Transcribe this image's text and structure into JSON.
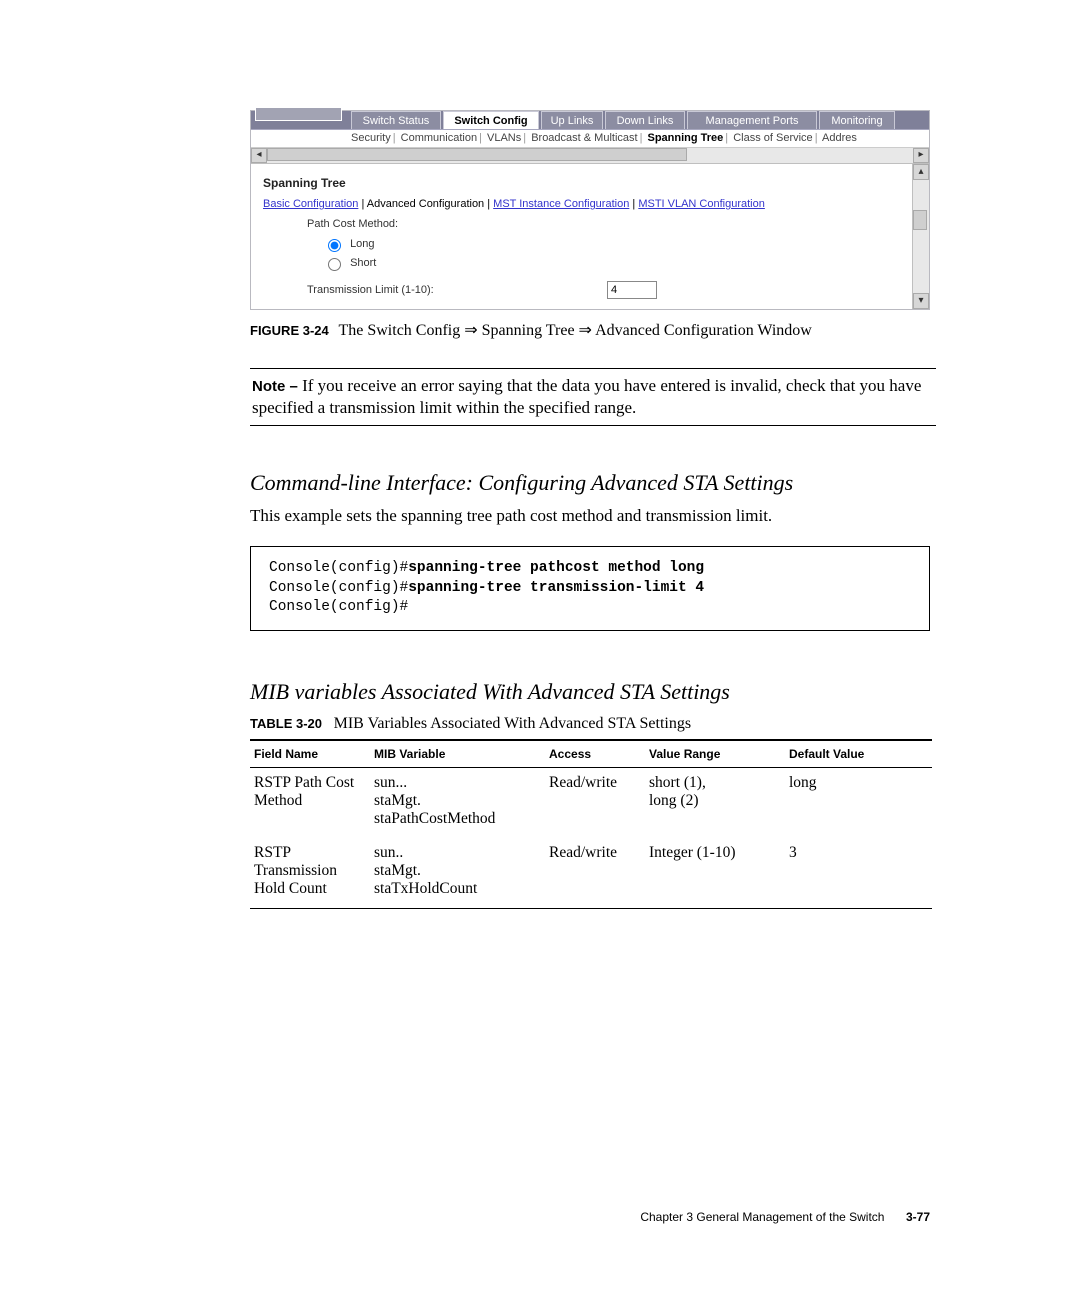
{
  "screenshot": {
    "tabs": [
      "Switch Status",
      "Switch Config",
      "Up Links",
      "Down Links",
      "Management Ports",
      "Monitoring"
    ],
    "active_tab_index": 1,
    "subtabs": [
      "Security",
      "Communication",
      "VLANs",
      "Broadcast & Multicast",
      "Spanning Tree",
      "Class of Service",
      "Addres"
    ],
    "active_subtab_index": 4,
    "panel_title": "Spanning Tree",
    "links": [
      "Basic Configuration",
      "Advanced Configuration",
      "MST Instance Configuration",
      "MSTI VLAN Configuration"
    ],
    "plain_link_index": 1,
    "path_cost_label": "Path Cost Method:",
    "radio_long": "Long",
    "radio_short": "Short",
    "radio_selected": "long",
    "tx_label": "Transmission Limit (1-10):",
    "tx_value": "4"
  },
  "figure": {
    "label": "FIGURE 3-24",
    "caption": "The Switch Config ⇒ Spanning Tree ⇒ Advanced Configuration Window"
  },
  "note": {
    "lead": "Note –",
    "text": "If you receive an error saying that the data you have entered is invalid, check that you have specified a transmission limit within the specified range."
  },
  "cli": {
    "heading": "Command-line Interface: Configuring Advanced STA Settings",
    "intro": "This example sets the spanning tree path cost method and transmission limit.",
    "prompt1": "Console(config)#",
    "cmd1": "spanning-tree pathcost method long",
    "prompt2": "Console(config)#",
    "cmd2": "spanning-tree transmission-limit 4",
    "prompt3": "Console(config)#"
  },
  "mib": {
    "heading": "MIB variables Associated With Advanced STA Settings",
    "table_label": "TABLE 3-20",
    "table_title": "MIB Variables Associated With Advanced STA Settings",
    "headers": [
      "Field Name",
      "MIB Variable",
      "Access",
      "Value Range",
      "Default Value"
    ],
    "rows": [
      {
        "field": "RSTP Path Cost Method",
        "var": "sun...\nstaMgt.\nstaPathCostMethod",
        "access": "Read/write",
        "range": "short (1),\nlong (2)",
        "default": "long"
      },
      {
        "field": "RSTP Transmission Hold Count",
        "var": "sun..\nstaMgt.\nstaTxHoldCount",
        "access": "Read/write",
        "range": "Integer (1-10)",
        "default": "3"
      }
    ]
  },
  "footer": {
    "chapter": "Chapter 3    General Management of the Switch",
    "page": "3-77"
  }
}
